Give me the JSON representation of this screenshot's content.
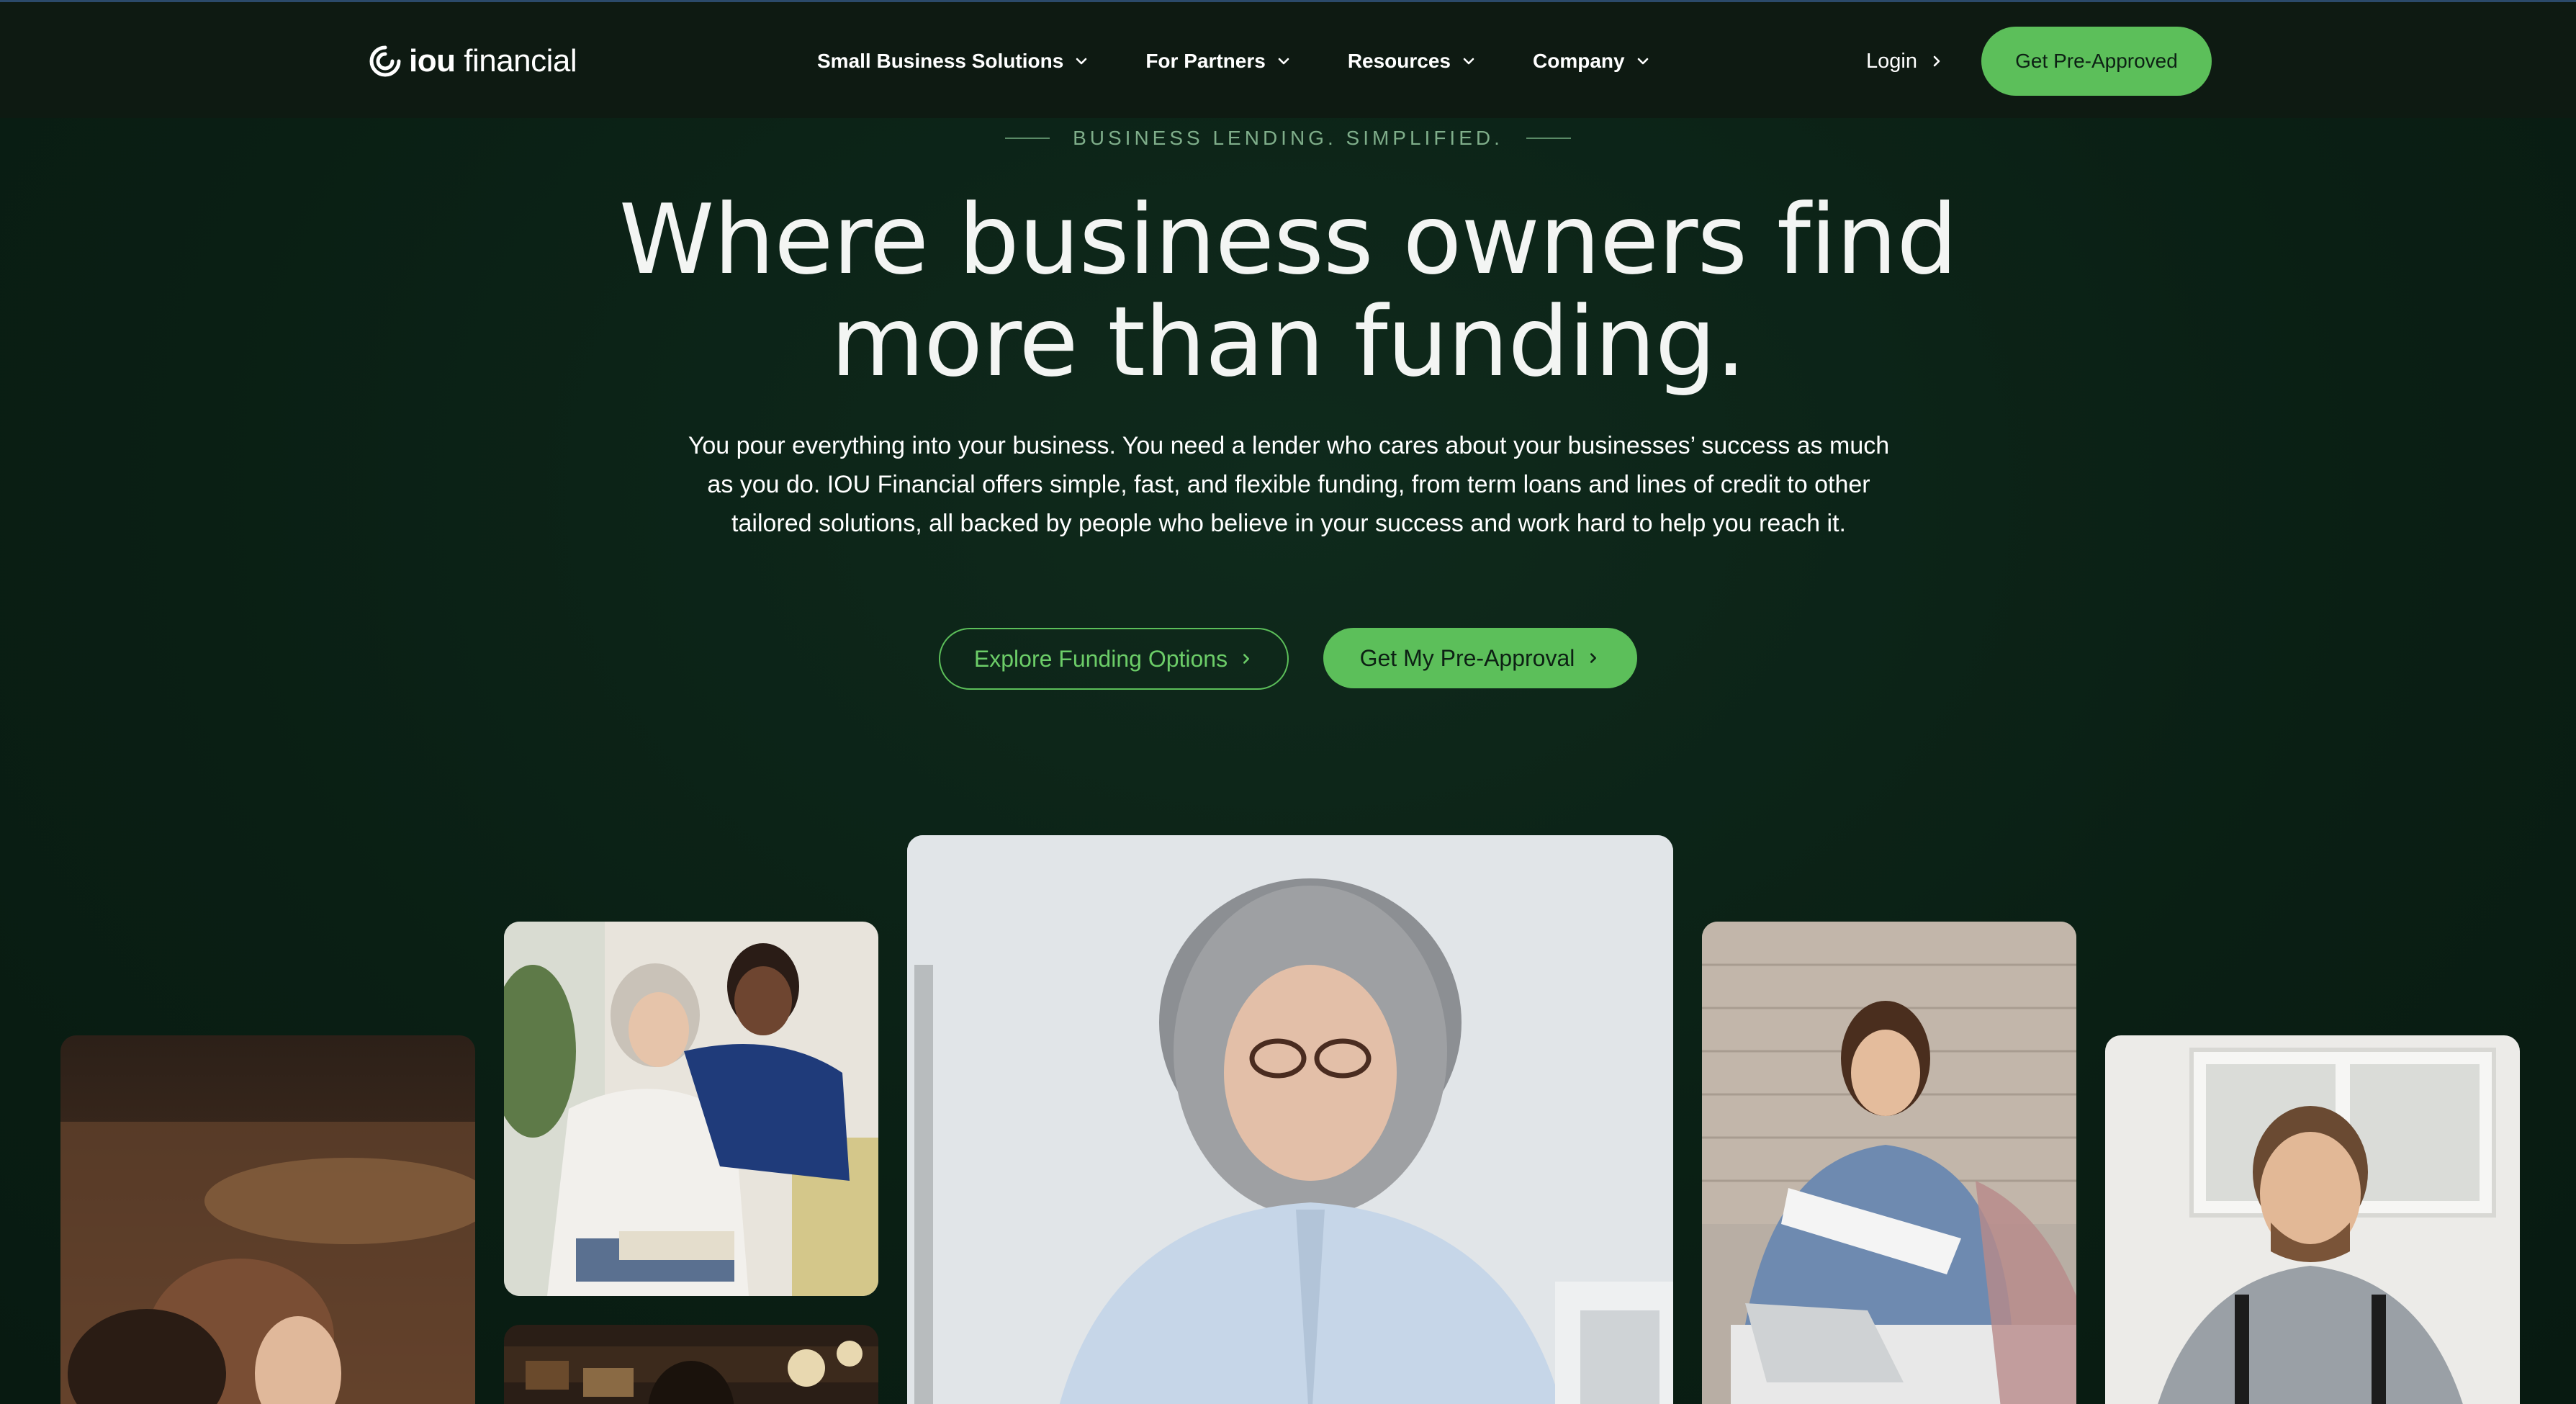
{
  "brand": {
    "logo_bold": "iou",
    "logo_light": "financial"
  },
  "nav": {
    "items": [
      {
        "label": "Small Business Solutions"
      },
      {
        "label": "For Partners"
      },
      {
        "label": "Resources"
      },
      {
        "label": "Company"
      }
    ],
    "login_label": "Login",
    "cta_label": "Get Pre-Approved"
  },
  "hero": {
    "eyebrow": "BUSINESS LENDING. SIMPLIFIED.",
    "headline_line1": "Where business owners find",
    "headline_line2": "more than funding.",
    "body": "You pour everything into your business. You need a lender who cares about your businesses’ success as much as you do. IOU Financial offers simple, fast, and flexible funding, from term loans and lines of credit to other tailored solutions, all backed by people who believe in your success and work hard to help you reach it.",
    "explore_label": "Explore Funding Options",
    "preapproval_label": "Get My Pre-Approval"
  },
  "colors": {
    "background": "#0b2116",
    "header": "#0e1a12",
    "accent": "#5cbf5a",
    "eyebrow": "#7fae8a"
  }
}
